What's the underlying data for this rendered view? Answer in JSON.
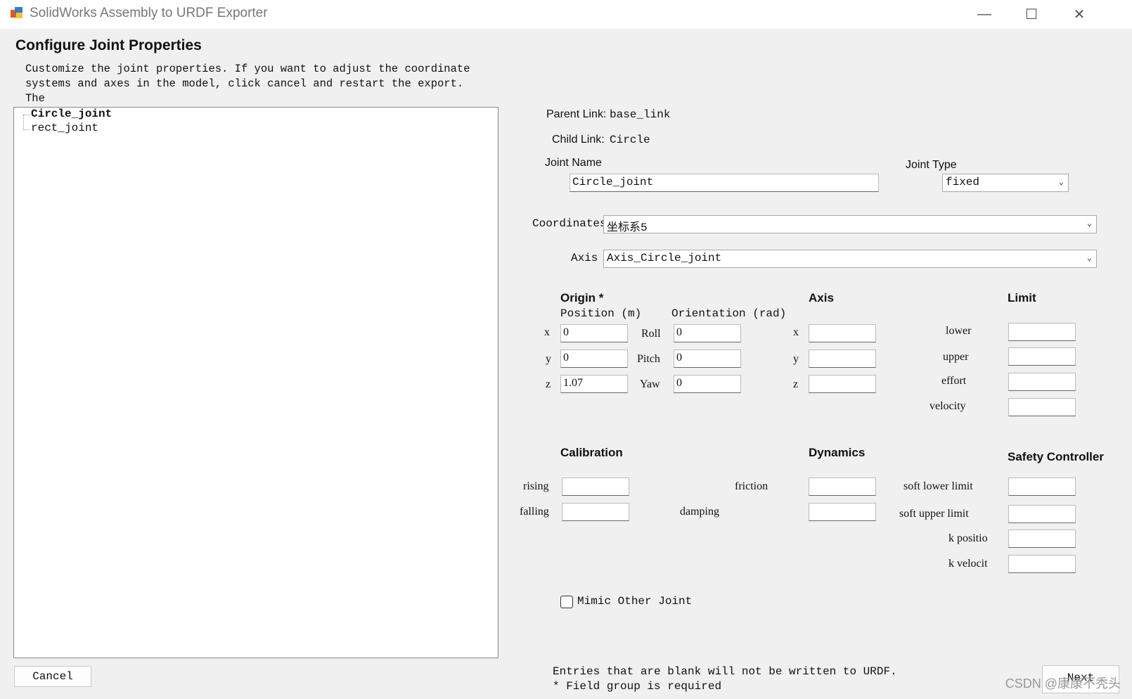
{
  "window": {
    "title": "SolidWorks Assembly to URDF Exporter",
    "controls": {
      "minimize": "—",
      "maximize": "☐",
      "close": "✕"
    }
  },
  "heading": "Configure Joint Properties",
  "description": "Customize the joint properties. If you want to adjust the coordinate\nsystems and axes in the model, click cancel and restart the export. The\ntool will recognize your changes on the next run.",
  "tree": {
    "items": [
      "Circle_joint",
      "rect_joint"
    ],
    "selected": "Circle_joint"
  },
  "parent_link": {
    "label": "Parent Link:",
    "value": "base_link"
  },
  "child_link": {
    "label": "Child Link:",
    "value": "Circle"
  },
  "joint_name": {
    "label": "Joint Name",
    "value": "Circle_joint"
  },
  "joint_type": {
    "label": "Joint Type",
    "value": "fixed"
  },
  "coordinates": {
    "label": "Coordinates",
    "value": "坐标系5"
  },
  "axis_select": {
    "label": "Axis",
    "value": "Axis_Circle_joint"
  },
  "origin": {
    "title": "Origin *",
    "position_label": "Position (m)",
    "orientation_label": "Orientation (rad)",
    "x_label": "x",
    "y_label": "y",
    "z_label": "z",
    "x": "0",
    "y": "0",
    "z": "1.07",
    "roll_label": "Roll",
    "pitch_label": "Pitch",
    "yaw_label": "Yaw",
    "roll": "0",
    "pitch": "0",
    "yaw": "0"
  },
  "axis": {
    "title": "Axis",
    "x_label": "x",
    "y_label": "y",
    "z_label": "z",
    "x": "",
    "y": "",
    "z": ""
  },
  "limit": {
    "title": "Limit",
    "lower_label": "lower",
    "upper_label": "upper",
    "effort_label": "effort",
    "velocity_label": "velocity",
    "lower": "",
    "upper": "",
    "effort": "",
    "velocity": ""
  },
  "calibration": {
    "title": "Calibration",
    "rising_label": "rising",
    "falling_label": "falling",
    "rising": "",
    "falling": ""
  },
  "dynamics": {
    "title": "Dynamics",
    "friction_label": "friction",
    "damping_label": "damping",
    "friction": "",
    "damping": ""
  },
  "safety": {
    "title": "Safety Controller",
    "soft_lower_label": "soft lower limit",
    "soft_upper_label": "soft upper limit",
    "k_position_label": "k positio",
    "k_velocity_label": "k velocit",
    "soft_lower": "",
    "soft_upper": "",
    "k_position": "",
    "k_velocity": ""
  },
  "mimic": {
    "label": "Mimic Other Joint",
    "checked": false
  },
  "footer": {
    "note1": "Entries that are blank will not be written to URDF.",
    "note2": "* Field group is required",
    "cancel": "Cancel",
    "next": "Next"
  },
  "watermark": "CSDN @康康不秃头"
}
